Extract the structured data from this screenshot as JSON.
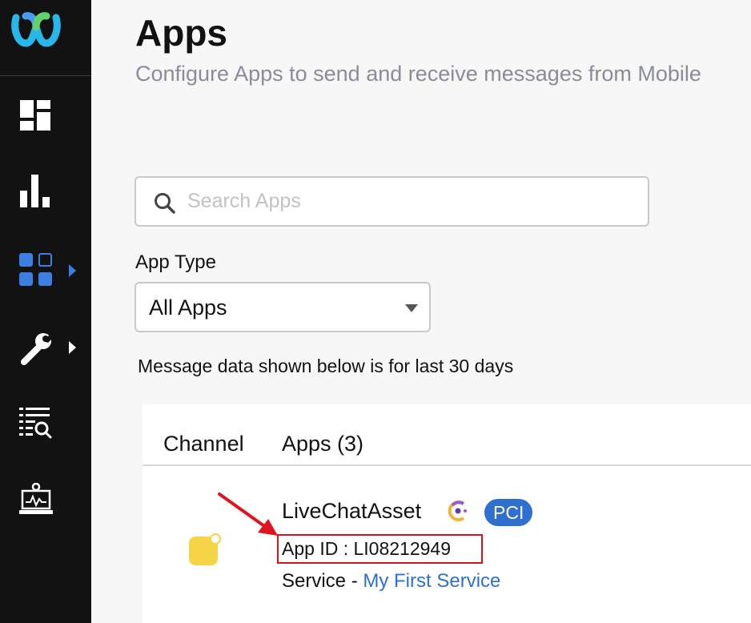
{
  "page": {
    "title": "Apps",
    "subtitle": "Configure Apps to send and receive messages from Mobile"
  },
  "search": {
    "placeholder": "Search Apps",
    "value": ""
  },
  "filter": {
    "label": "App Type",
    "selected": "All Apps"
  },
  "note": "Message data shown below is for last 30 days",
  "table": {
    "headers": [
      "Channel",
      "Apps (3)"
    ]
  },
  "app": {
    "name": "LiveChatAsset",
    "badge": "PCI",
    "id_text": "App ID : LI08212949",
    "service_label": "Service - ",
    "service_link": "My First Service",
    "icon_color": "#f5d547"
  },
  "colors": {
    "sidebar_bg": "#121212",
    "accent": "#2f6fcf",
    "highlight_red": "#d4141e"
  },
  "sidebar": {
    "items": [
      "webex-logo-icon",
      "dashboard-icon",
      "analytics-icon",
      "apps-icon",
      "tools-icon",
      "reports-search-icon",
      "monitor-icon"
    ],
    "active": "apps-icon"
  }
}
